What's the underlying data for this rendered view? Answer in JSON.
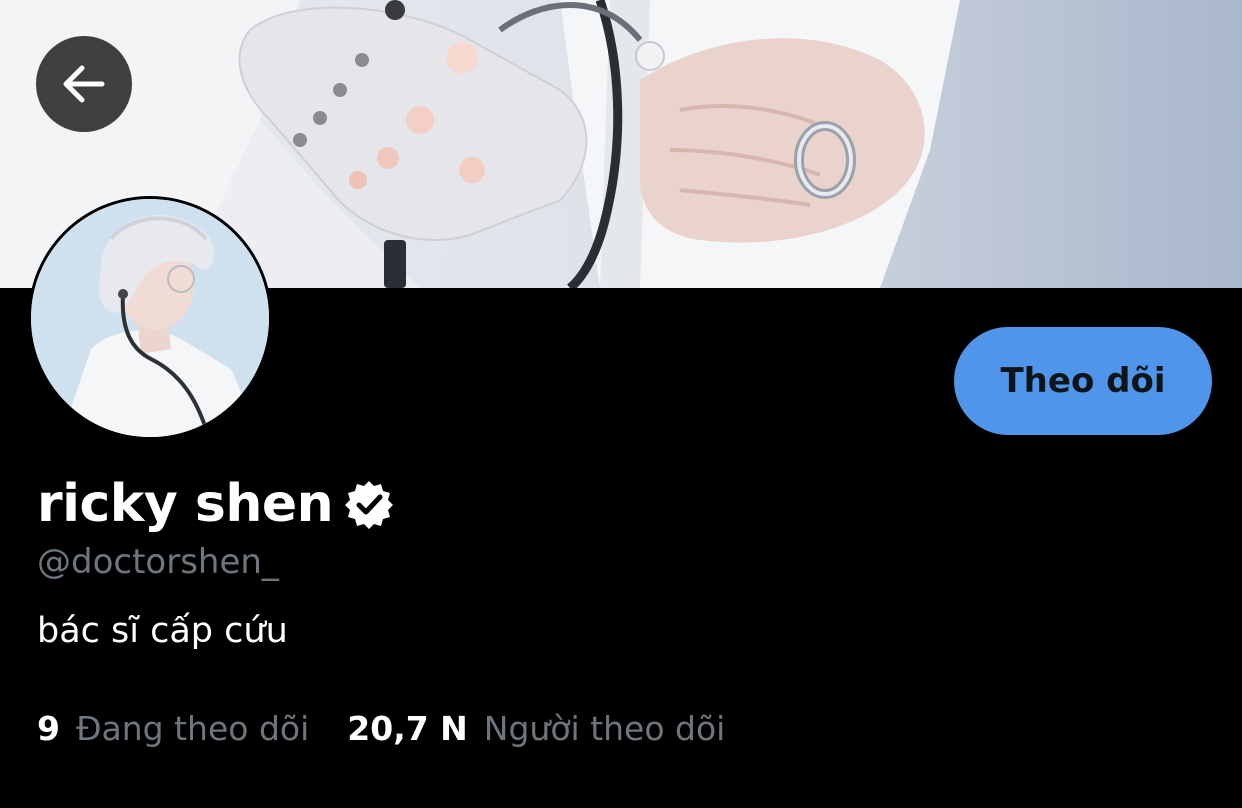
{
  "banner": {
    "description_icon": "cover-photo"
  },
  "nav": {
    "back_icon": "arrow-left-icon"
  },
  "profile": {
    "display_name": "ricky shen",
    "handle": "@doctorshen_",
    "bio": "bác sĩ cấp cứu",
    "verified": true
  },
  "actions": {
    "follow_label": "Theo dõi"
  },
  "stats": {
    "following_count": "9",
    "following_label": "Đang theo dõi",
    "followers_count": "20,7 N",
    "followers_label": "Người theo dõi"
  },
  "colors": {
    "background": "#000000",
    "accent": "#4f96ea",
    "secondary_text": "#6e767d",
    "primary_text": "#ffffff"
  }
}
